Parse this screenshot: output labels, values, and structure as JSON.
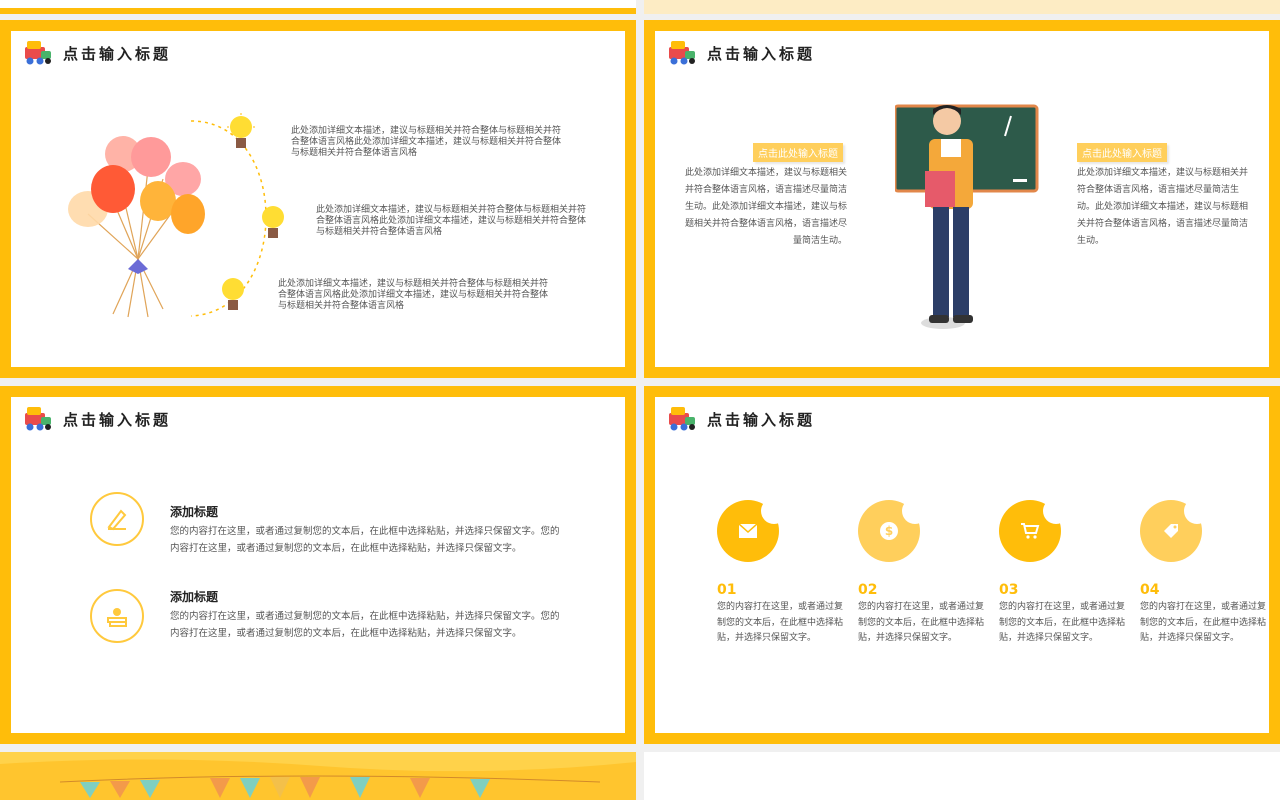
{
  "colors": {
    "accent": "#ffbd0a",
    "accent_light": "#ffcf5c",
    "text": "#555555"
  },
  "slide_title": "点击输入标题",
  "slide1": {
    "items": [
      {
        "text": "此处添加详细文本描述，建议与标题相关并符合整体与标题相关并符合整体语言风格此处添加详细文本描述，建议与标题相关并符合整体与标题相关并符合整体语言风格"
      },
      {
        "text": "此处添加详细文本描述，建议与标题相关并符合整体与标题相关并符合整体语言风格此处添加详细文本描述，建议与标题相关并符合整体与标题相关并符合整体语言风格"
      },
      {
        "text": "此处添加详细文本描述，建议与标题相关并符合整体与标题相关并符合整体语言风格此处添加详细文本描述，建议与标题相关并符合整体与标题相关并符合整体语言风格"
      }
    ]
  },
  "slide2": {
    "left_tag": "点击此处输入标题",
    "left_text": "此处添加详细文本描述，建议与标题相关并符合整体语言风格，语言描述尽量简洁生动。此处添加详细文本描述，建议与标题相关并符合整体语言风格，语言描述尽量简洁生动。",
    "right_tag": "点击此处输入标题",
    "right_text": "此处添加详细文本描述，建议与标题相关并符合整体语言风格，语言描述尽量简洁生动。此处添加详细文本描述，建议与标题相关并符合整体语言风格，语言描述尽量简洁生动。"
  },
  "slide3": {
    "features": [
      {
        "title": "添加标题",
        "text": "您的内容打在这里，或者通过复制您的文本后，在此框中选择粘贴，并选择只保留文字。您的内容打在这里，或者通过复制您的文本后，在此框中选择粘贴，并选择只保留文字。",
        "icon": "pen-ruler-icon"
      },
      {
        "title": "添加标题",
        "text": "您的内容打在这里，或者通过复制您的文本后，在此框中选择粘贴，并选择只保留文字。您的内容打在这里，或者通过复制您的文本后，在此框中选择粘贴，并选择只保留文字。",
        "icon": "books-apple-icon"
      }
    ]
  },
  "slide4": {
    "columns": [
      {
        "num": "01",
        "icon": "mail-icon",
        "color": "#ffbd0a",
        "text": "您的内容打在这里，或者通过复制您的文本后，在此框中选择粘贴，并选择只保留文字。"
      },
      {
        "num": "02",
        "icon": "money-bag-icon",
        "color": "#ffcf5c",
        "text": "您的内容打在这里，或者通过复制您的文本后，在此框中选择粘贴，并选择只保留文字。"
      },
      {
        "num": "03",
        "icon": "cart-icon",
        "color": "#ffbd0a",
        "text": "您的内容打在这里，或者通过复制您的文本后，在此框中选择粘贴，并选择只保留文字。"
      },
      {
        "num": "04",
        "icon": "tag-icon",
        "color": "#ffcf5c",
        "text": "您的内容打在这里，或者通过复制您的文本后，在此框中选择粘贴，并选择只保留文字。"
      }
    ]
  }
}
